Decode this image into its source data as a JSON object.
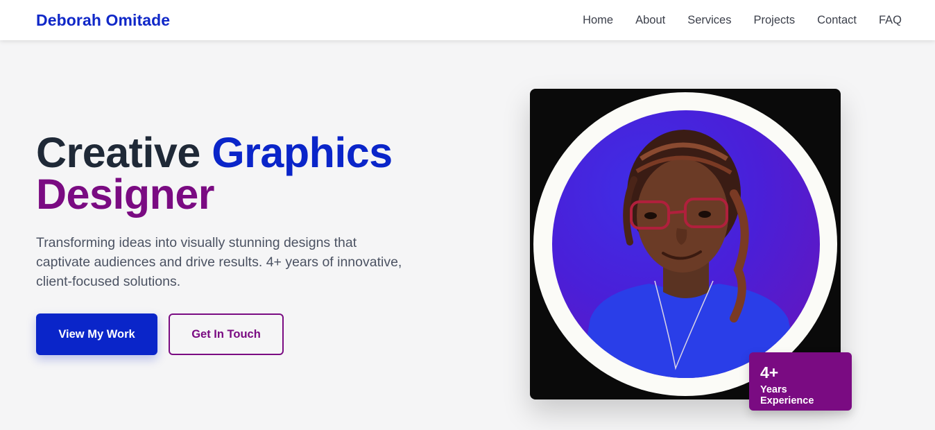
{
  "brand": {
    "name": "Deborah Omitade"
  },
  "nav": {
    "items": [
      "Home",
      "About",
      "Services",
      "Projects",
      "Contact",
      "FAQ"
    ]
  },
  "hero": {
    "title_part1": "Creative",
    "title_part2": "Graphics",
    "title_part3": "Designer",
    "description": "Transforming ideas into visually stunning designs that captivate audiences and drive results. 4+ years of innovative, client-focused solutions.",
    "primary_button": "View My Work",
    "secondary_button": "Get In Touch"
  },
  "badge": {
    "number": "4+",
    "label": "Years Experience"
  },
  "colors": {
    "brand_blue": "#0a25c9",
    "accent_purple": "#7a0b82",
    "background": "#f5f5f6"
  }
}
